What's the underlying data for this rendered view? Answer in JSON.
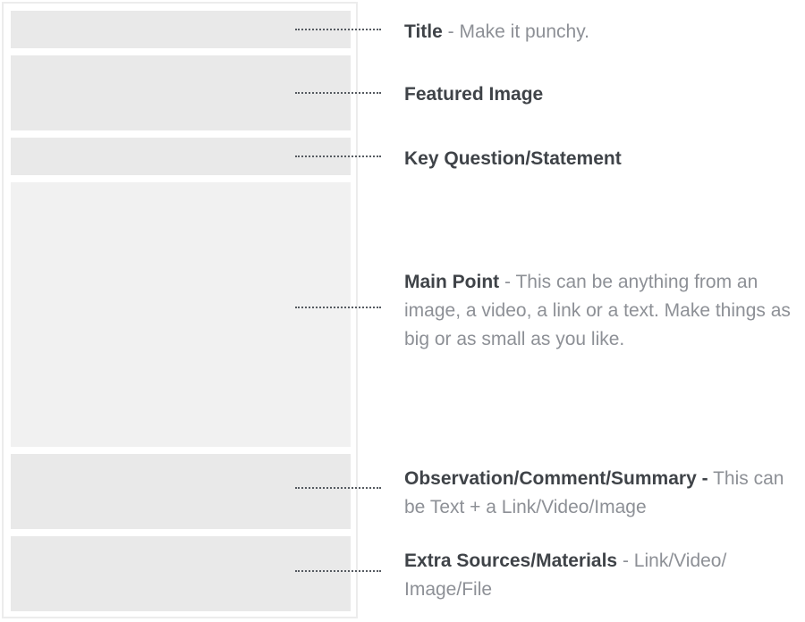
{
  "sections": [
    {
      "id": "title",
      "heading": "Title",
      "description": "- Make it punchy."
    },
    {
      "id": "featured-image",
      "heading": "Featured Image",
      "description": ""
    },
    {
      "id": "key-question",
      "heading": "Key Question/Statement",
      "description": ""
    },
    {
      "id": "main-point",
      "heading": "Main Point",
      "description": "- This can be anything from an image, a video, a link or a text. Make things as big or as small as you like."
    },
    {
      "id": "observation",
      "heading": "Observation/Comment/Summary -",
      "description": "This can be Text + a Link/Video/Image"
    },
    {
      "id": "extra-sources",
      "heading": "Extra Sources/Materials",
      "description": "- Link/Video/ Image/File"
    }
  ],
  "colors": {
    "block_fill": "#e9e9e9",
    "block_fill_light": "#f1f1f1",
    "frame_border": "#ececec",
    "heading_text": "#3f4348",
    "description_text": "#8d9096",
    "leader_line": "#555a60"
  }
}
